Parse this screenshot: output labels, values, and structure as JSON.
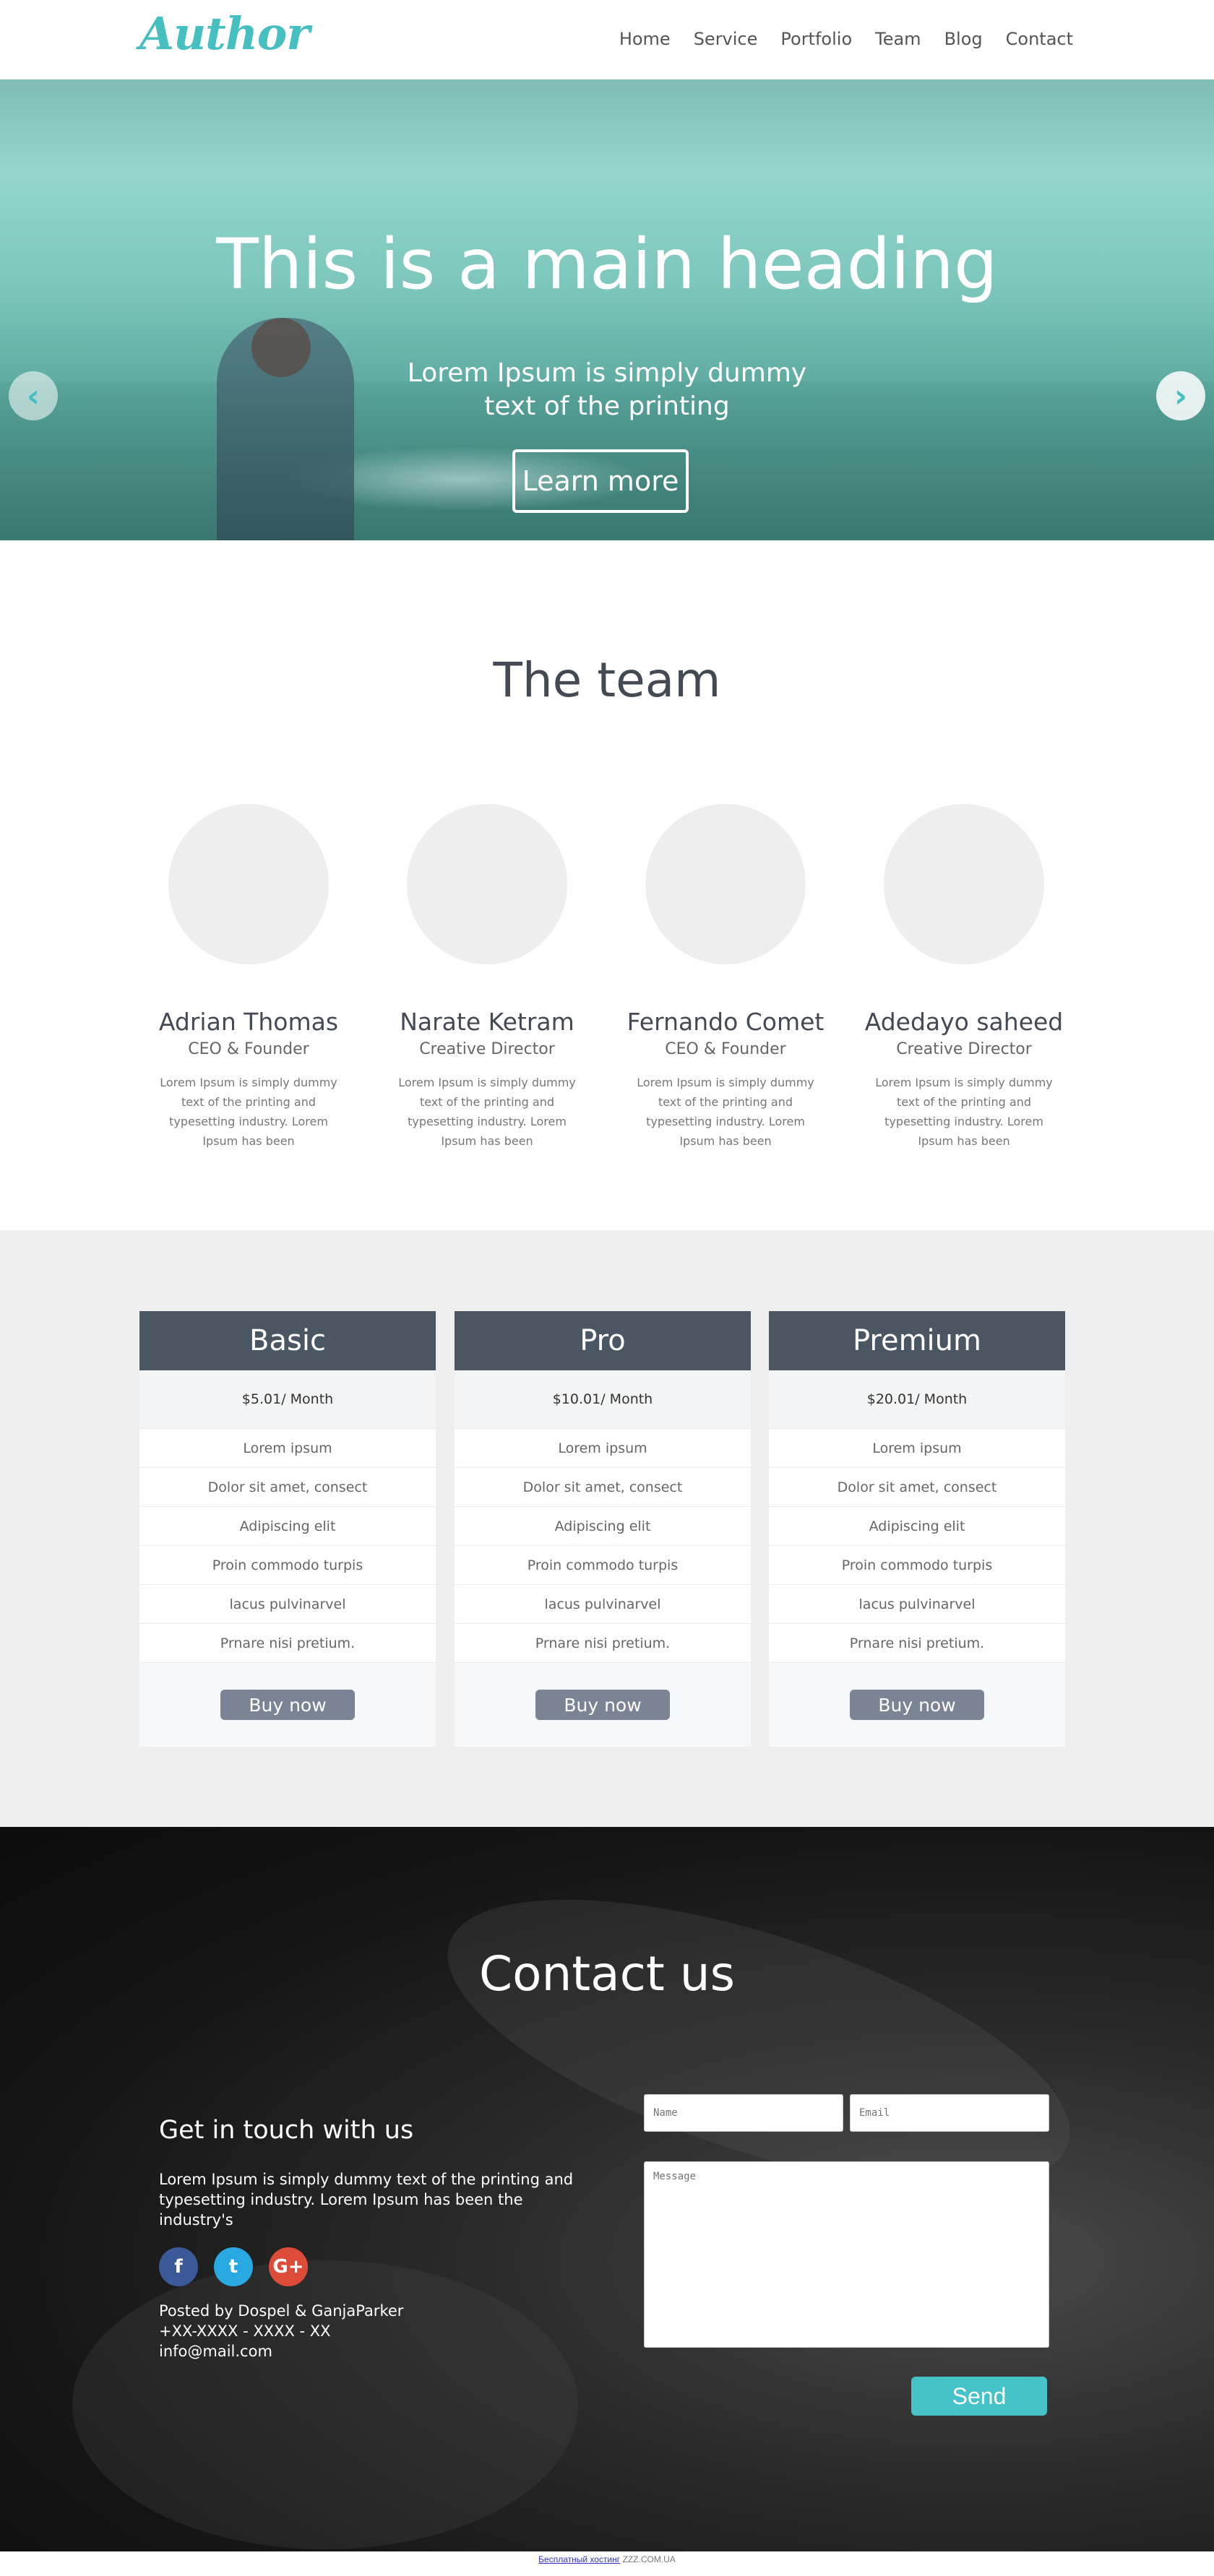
{
  "header": {
    "logo": "Author",
    "nav": [
      "Home",
      "Service",
      "Portfolio",
      "Team",
      "Blog",
      "Contact"
    ]
  },
  "hero": {
    "heading": "This is a main heading",
    "subtext": "Lorem Ipsum is simply dummy text of the printing",
    "button": "Learn more",
    "prev_icon": "chevron-left-icon",
    "next_icon": "chevron-right-icon"
  },
  "team": {
    "title": "The team",
    "members": [
      {
        "name": "Adrian Thomas",
        "role": "CEO & Founder",
        "desc": "Lorem Ipsum is simply dummy text of the printing and typesetting industry. Lorem Ipsum has been"
      },
      {
        "name": "Narate Ketram",
        "role": "Creative Director",
        "desc": "Lorem Ipsum is simply dummy text of the printing and typesetting industry. Lorem Ipsum has been"
      },
      {
        "name": "Fernando Comet",
        "role": "CEO & Founder",
        "desc": "Lorem Ipsum is simply dummy text of the printing and typesetting industry. Lorem Ipsum has been"
      },
      {
        "name": "Adedayo saheed",
        "role": "Creative Director",
        "desc": "Lorem Ipsum is simply dummy text of the printing and typesetting industry. Lorem Ipsum has been"
      }
    ]
  },
  "pricing": {
    "plans": [
      {
        "title": "Basic",
        "price": "$5.01/ Month",
        "features": [
          "Lorem ipsum",
          "Dolor sit amet, consect",
          "Adipiscing elit",
          "Proin commodo turpis",
          "lacus pulvinarvel",
          "Prnare nisi pretium."
        ],
        "button": "Buy now"
      },
      {
        "title": "Pro",
        "price": "$10.01/ Month",
        "features": [
          "Lorem ipsum",
          "Dolor sit amet, consect",
          "Adipiscing elit",
          "Proin commodo turpis",
          "lacus pulvinarvel",
          "Prnare nisi pretium."
        ],
        "button": "Buy now"
      },
      {
        "title": "Premium",
        "price": "$20.01/ Month",
        "features": [
          "Lorem ipsum",
          "Dolor sit amet, consect",
          "Adipiscing elit",
          "Proin commodo turpis",
          "lacus pulvinarvel",
          "Prnare nisi pretium."
        ],
        "button": "Buy now"
      }
    ]
  },
  "contact": {
    "title": "Contact us",
    "subtitle": "Get in touch with us",
    "text": "Lorem Ipsum is simply dummy text of the printing and typesetting industry. Lorem Ipsum has been the industry's",
    "social": [
      "facebook-icon",
      "twitter-icon",
      "google-plus-icon"
    ],
    "posted_by": "Posted by Dospel & GanjaParker",
    "phone": "+XX-XXXX - XXXX - XX",
    "email": "info@mail.com",
    "form": {
      "name_placeholder": "Name",
      "email_placeholder": "Email",
      "message_placeholder": "Message",
      "send": "Send"
    }
  },
  "footer": {
    "link": "Бесплатный хостинг",
    "text": " ZZZ.COM.UA"
  },
  "colors": {
    "accent": "#45bfbf",
    "plan_header": "#4b5663",
    "buy_button": "#7a8494",
    "send_button": "#45c3c8"
  }
}
